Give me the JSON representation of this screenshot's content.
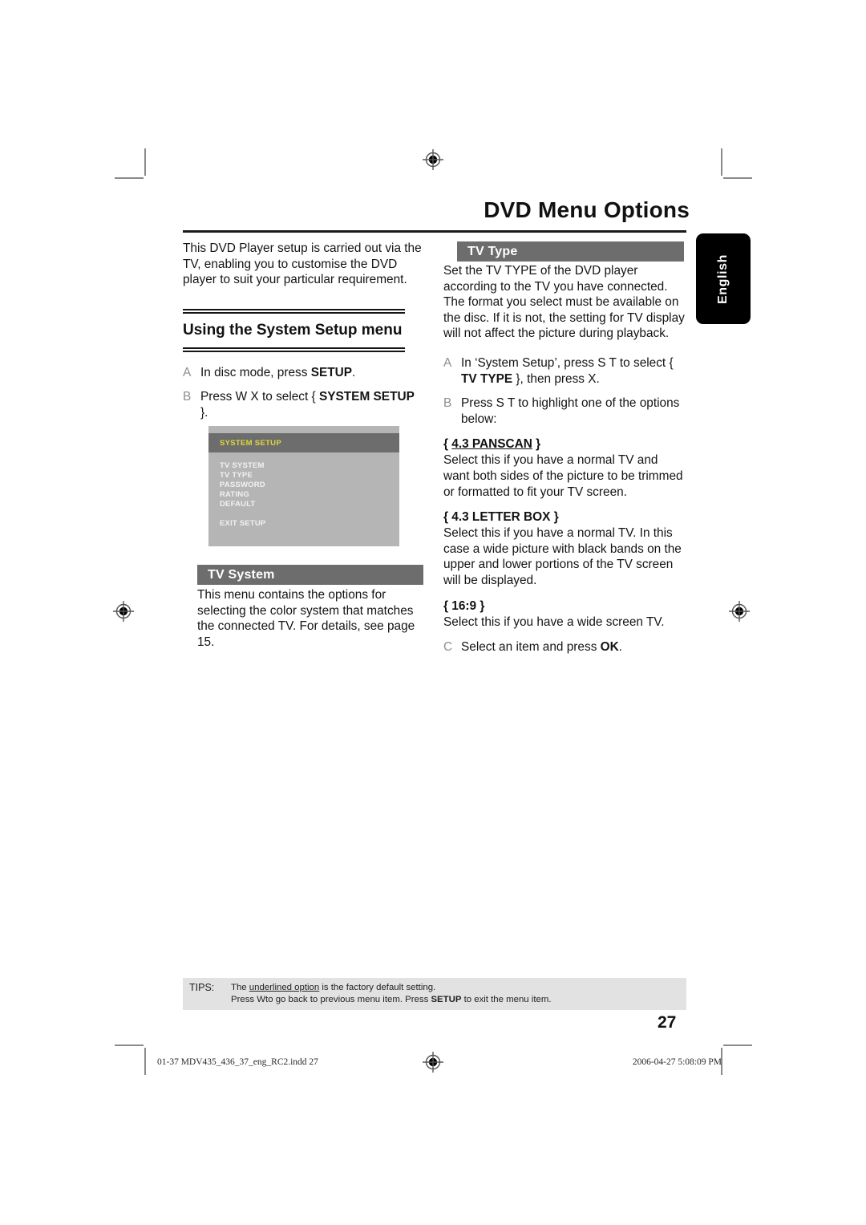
{
  "document": {
    "chapter_title": "DVD Menu Options",
    "language_tab": "English",
    "page_number": "27"
  },
  "left_column": {
    "intro": "This DVD Player setup is carried out via the TV, enabling you to customise the DVD player to suit your particular requirement.",
    "section_title": "Using the System Setup menu",
    "steps": [
      {
        "letter": "A",
        "text_before": "In disc mode, press ",
        "bold": "SETUP",
        "text_after": "."
      },
      {
        "letter": "B",
        "text_before": "Press  W X to select { ",
        "bold": "SYSTEM SETUP",
        "text_after": " }."
      }
    ],
    "osd_menu": {
      "header": "SYSTEM SETUP",
      "items": [
        "TV SYSTEM",
        "TV TYPE",
        "PASSWORD",
        "RATING",
        "DEFAULT"
      ],
      "exit_item": "EXIT SETUP",
      "header_bg": "#6d6d6d",
      "header_text_color": "#ddd83c",
      "body_bg": "#b5b5b5",
      "item_text_color": "#f2f2f2"
    },
    "tv_system": {
      "bar_title": "TV System",
      "body": "This menu contains the options for selecting the color system that matches the connected TV. For details, see page 15."
    }
  },
  "right_column": {
    "tv_type": {
      "bar_title": "TV Type",
      "body": "Set the TV TYPE of the DVD player according to the TV you have connected. The format you select must be available on the disc. If it is not, the setting for TV display will not affect the picture during playback.",
      "steps": [
        {
          "letter": "A",
          "text_before": "In ‘System Setup’, press  S  T to select { ",
          "bold": "TV TYPE",
          "text_after": " }, then press  X."
        },
        {
          "letter": "B",
          "text_before": "Press  S T  to highlight one of the options below:",
          "bold": "",
          "text_after": ""
        },
        {
          "letter": "C",
          "text_before": "Select an item and press ",
          "bold": "OK",
          "text_after": "."
        }
      ],
      "options": [
        {
          "label": "{ 4.3 PANSCAN }",
          "label_core": "4.3 PANSCAN",
          "underlined": true,
          "description": "Select this if you have a normal TV and want both sides of the picture to be trimmed or formatted to fit your TV screen."
        },
        {
          "label": "{ 4.3 LETTER BOX }",
          "label_core": "4.3 LETTER BOX",
          "underlined": false,
          "description": "Select this if you have a normal TV. In this case a wide picture with black bands on the upper and lower portions of the TV screen will be displayed."
        },
        {
          "label": "{ 16:9 }",
          "label_core": "16:9",
          "underlined": false,
          "description": "Select this if you have a wide screen TV."
        }
      ]
    }
  },
  "tips": {
    "label": "TIPS:",
    "line1_before": "The ",
    "line1_underlined": "underlined option",
    "line1_after": " is the factory default setting.",
    "line2_before": "Press    Wto go back to previous menu item. Press ",
    "line2_bold": "SETUP",
    "line2_after": " to exit the menu item.",
    "background": "#e2e2e2"
  },
  "print_footer": {
    "left": "01-37 MDV435_436_37_eng_RC2.indd   27",
    "right": "2006-04-27   5:08:09 PM"
  }
}
